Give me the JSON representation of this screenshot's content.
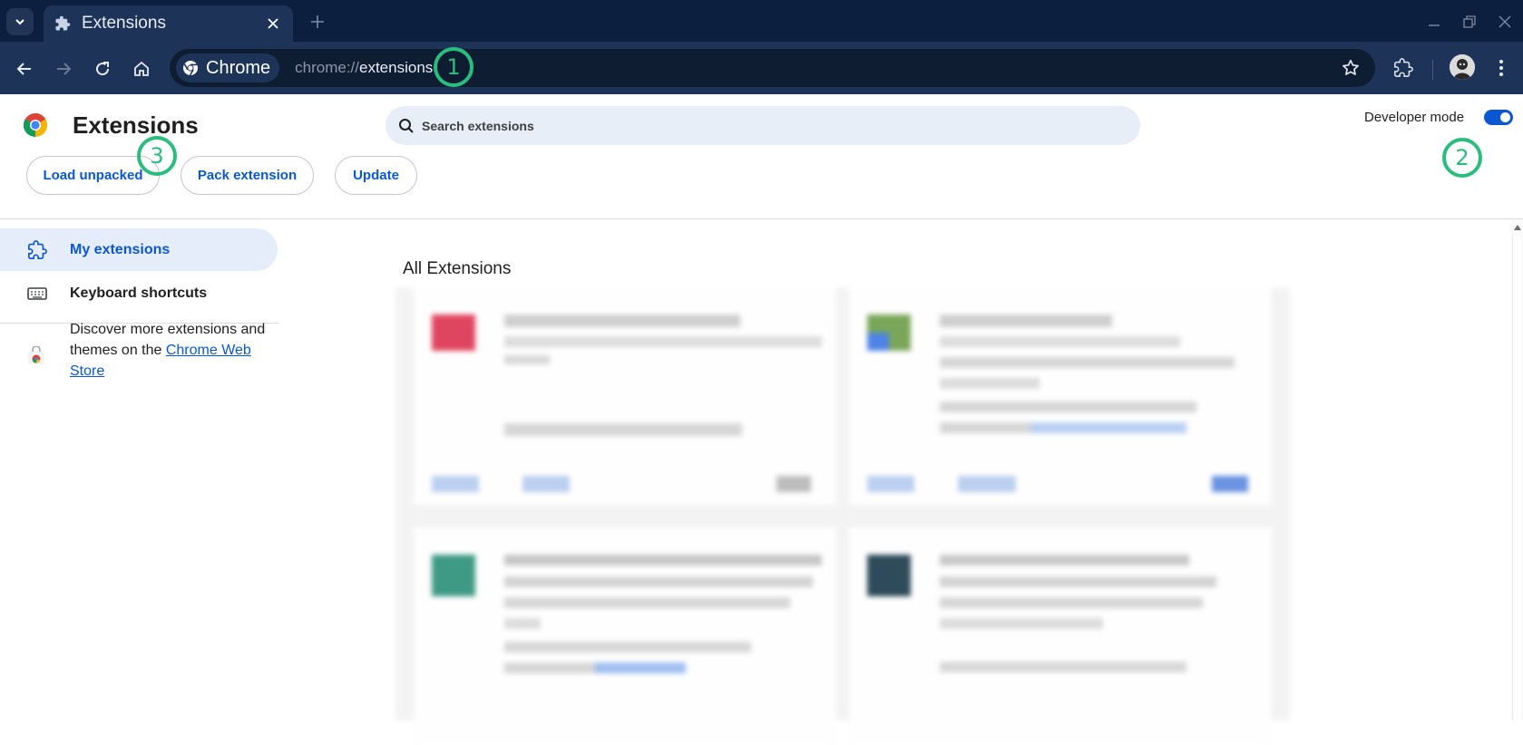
{
  "tab": {
    "title": "Extensions",
    "close_icon": "close-icon",
    "new_tab_icon": "plus-icon"
  },
  "omnibox": {
    "chip_label": "Chrome",
    "url_scheme": "chrome://",
    "url_path": "extensions"
  },
  "header": {
    "title": "Extensions",
    "search_placeholder": "Search extensions",
    "developer_mode_label": "Developer mode",
    "developer_mode_on": true
  },
  "actions": {
    "load_unpacked": "Load unpacked",
    "pack_extension": "Pack extension",
    "update": "Update"
  },
  "sidebar": {
    "items": [
      {
        "label": "My extensions",
        "active": true,
        "icon": "extension-puzzle-icon"
      },
      {
        "label": "Keyboard shortcuts",
        "active": false,
        "icon": "keyboard-icon"
      }
    ],
    "discover_prefix": "Discover more extensions and themes on the ",
    "discover_link": "Chrome Web Store"
  },
  "main": {
    "section_title": "All Extensions"
  },
  "markers": {
    "m1": "1",
    "m2": "2",
    "m3": "3"
  },
  "colors": {
    "accent": "#0b57d0",
    "marker": "#2bbd7e",
    "titlebar": "#0c1f3f",
    "toolbar": "#1d3458"
  }
}
